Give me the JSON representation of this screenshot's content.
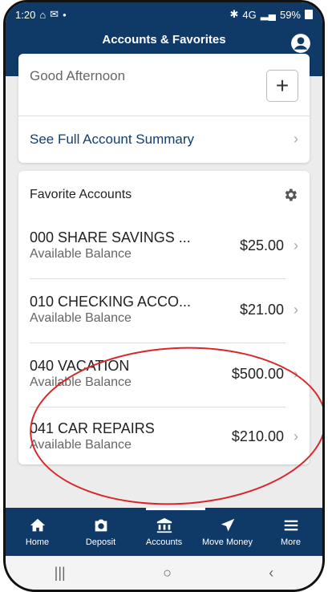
{
  "status": {
    "time": "1:20",
    "battery": "59%",
    "network": "4G"
  },
  "header": {
    "title": "Accounts & Favorites",
    "profile_icon": "person-circle-icon"
  },
  "greeting": {
    "text": "Good Afternoon",
    "add_label": "+"
  },
  "summary": {
    "label": "See Full Account Summary"
  },
  "favorites": {
    "title": "Favorite Accounts",
    "accounts": [
      {
        "name": "000 SHARE SAVINGS ...",
        "sub": "Available Balance",
        "balance": "$25.00"
      },
      {
        "name": "010 CHECKING ACCO...",
        "sub": "Available Balance",
        "balance": "$21.00"
      },
      {
        "name": "040 VACATION",
        "sub": "Available Balance",
        "balance": "$500.00"
      },
      {
        "name": "041 CAR REPAIRS",
        "sub": "Available Balance",
        "balance": "$210.00"
      }
    ]
  },
  "tabs": [
    {
      "label": "Home",
      "icon": "home-icon"
    },
    {
      "label": "Deposit",
      "icon": "camera-icon"
    },
    {
      "label": "Accounts",
      "icon": "bank-icon"
    },
    {
      "label": "Move Money",
      "icon": "arrow-icon"
    },
    {
      "label": "More",
      "icon": "menu-icon"
    }
  ],
  "colors": {
    "brand": "#0f3a68",
    "annotation": "#d8262a"
  }
}
